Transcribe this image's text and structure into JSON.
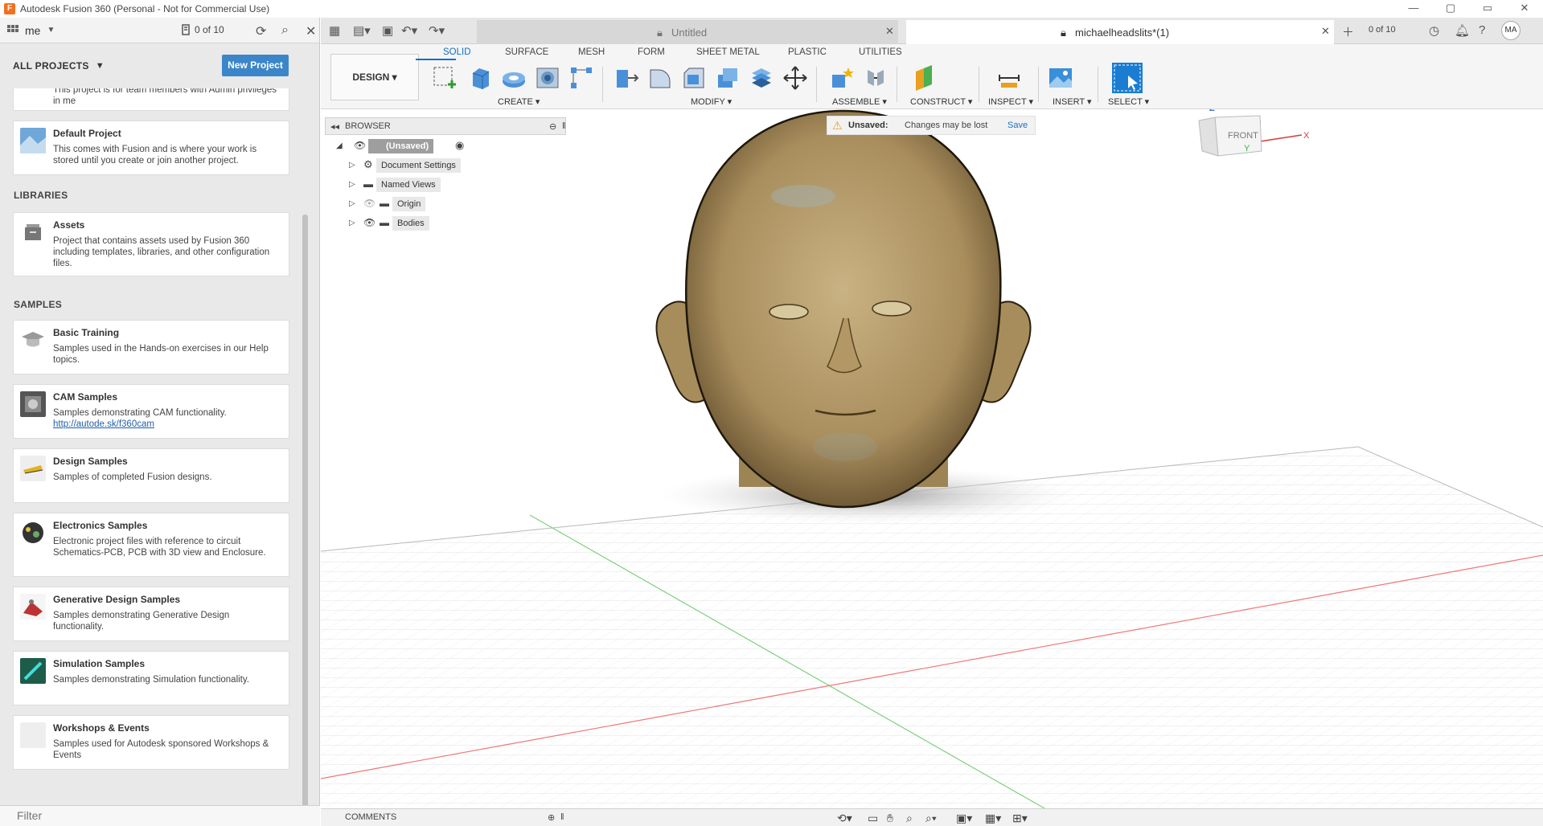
{
  "window": {
    "title": "Autodesk Fusion 360 (Personal - Not for Commercial Use)",
    "controls": [
      "—",
      "▢",
      "▭",
      "✕"
    ]
  },
  "data_panel": {
    "user": "me",
    "jobs": "0 of 10",
    "all_projects": "ALL PROJECTS",
    "new_project": "New Project",
    "truncated_card": {
      "desc": "This project is for team members with Admin privileges in me"
    },
    "default_project": {
      "name": "Default Project",
      "desc": "This comes with Fusion and is where your work is stored until you create or join another project."
    },
    "libraries_label": "LIBRARIES",
    "assets": {
      "name": "Assets",
      "desc": "Project that contains assets used by Fusion 360 including templates, libraries, and other configuration files."
    },
    "samples_label": "SAMPLES",
    "samples": [
      {
        "name": "Basic Training",
        "desc": "Samples used in the Hands-on exercises in our Help topics."
      },
      {
        "name": "CAM Samples",
        "desc": "Samples demonstrating CAM functionality.",
        "link": "http://autode.sk/f360cam"
      },
      {
        "name": "Design Samples",
        "desc": "Samples of completed Fusion designs."
      },
      {
        "name": "Electronics Samples",
        "desc": "Electronic project files with reference to circuit Schematics-PCB, PCB with 3D view and Enclosure."
      },
      {
        "name": "Generative Design Samples",
        "desc": "Samples demonstrating Generative Design functionality."
      },
      {
        "name": "Simulation Samples",
        "desc": "Samples demonstrating Simulation functionality."
      },
      {
        "name": "Workshops & Events",
        "desc": "Samples used for Autodesk sponsored Workshops & Events"
      }
    ],
    "filter_placeholder": "Filter"
  },
  "tabs": {
    "untitled": "Untitled",
    "active": "michaelheadslits*(1)",
    "jobs": "0 of 10",
    "avatar": "MA"
  },
  "ribbon": {
    "workspace": "DESIGN",
    "tabs": [
      "SOLID",
      "SURFACE",
      "MESH",
      "FORM",
      "SHEET METAL",
      "PLASTIC",
      "UTILITIES"
    ],
    "groups": [
      "CREATE",
      "MODIFY",
      "ASSEMBLE",
      "CONSTRUCT",
      "INSPECT",
      "INSERT",
      "SELECT"
    ]
  },
  "browser": {
    "title": "BROWSER",
    "root": "(Unsaved)",
    "items": [
      "Document Settings",
      "Named Views",
      "Origin",
      "Bodies"
    ]
  },
  "unsaved_bar": {
    "label": "Unsaved:",
    "message": "Changes may be lost",
    "save": "Save"
  },
  "viewcube": {
    "face": "FRONT",
    "axis_z": "Z",
    "axis_x": "X",
    "axis_y": "Y"
  },
  "bottom": {
    "comments": "COMMENTS"
  },
  "colors": {
    "accent": "#0f6fc6",
    "new_project_btn": "#3b86c8",
    "head_skin": "#b9a070",
    "grid_red": "#e04040",
    "grid_green": "#40c040"
  }
}
